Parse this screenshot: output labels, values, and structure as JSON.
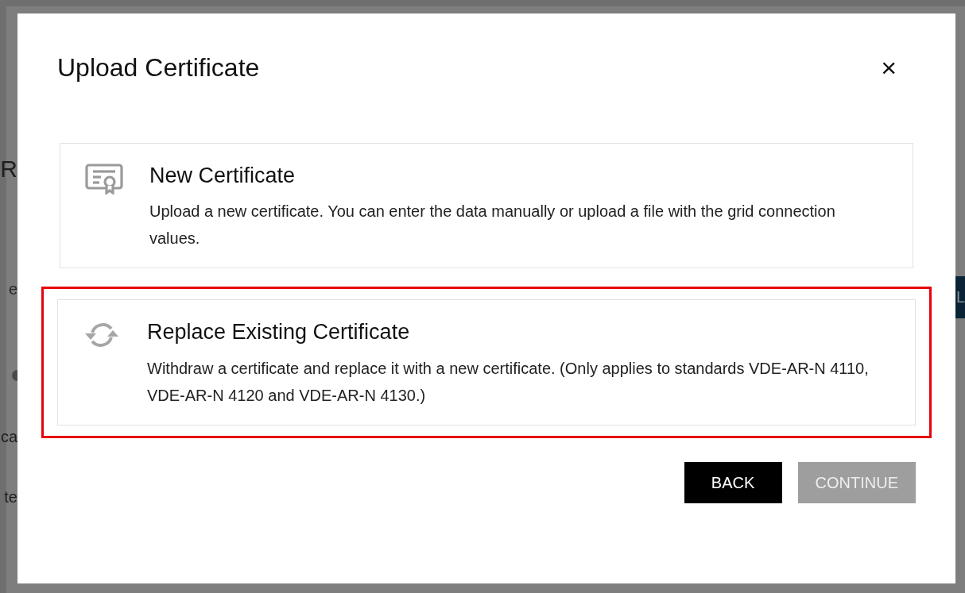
{
  "background_page": {
    "fragments": [
      "R",
      "e",
      "ca",
      "te"
    ],
    "side_button": "L"
  },
  "dialog": {
    "title": "Upload Certificate",
    "close": "×",
    "options": [
      {
        "kind": "certificate",
        "title": "New Certificate",
        "description": "Upload a new certificate. You can enter the data manually or upload a file with the grid connection values.",
        "highlighted": false
      },
      {
        "kind": "replace",
        "title": "Replace Existing Certificate",
        "description": "Withdraw a certificate and replace it with a new certificate. (Only applies to standards VDE-AR-N 4110, VDE-AR-N 4120 and VDE-AR-N 4130.)",
        "highlighted": true
      }
    ],
    "buttons": [
      {
        "label": "BACK",
        "disabled": false
      },
      {
        "label": "CONTINUE",
        "disabled": true
      }
    ]
  }
}
